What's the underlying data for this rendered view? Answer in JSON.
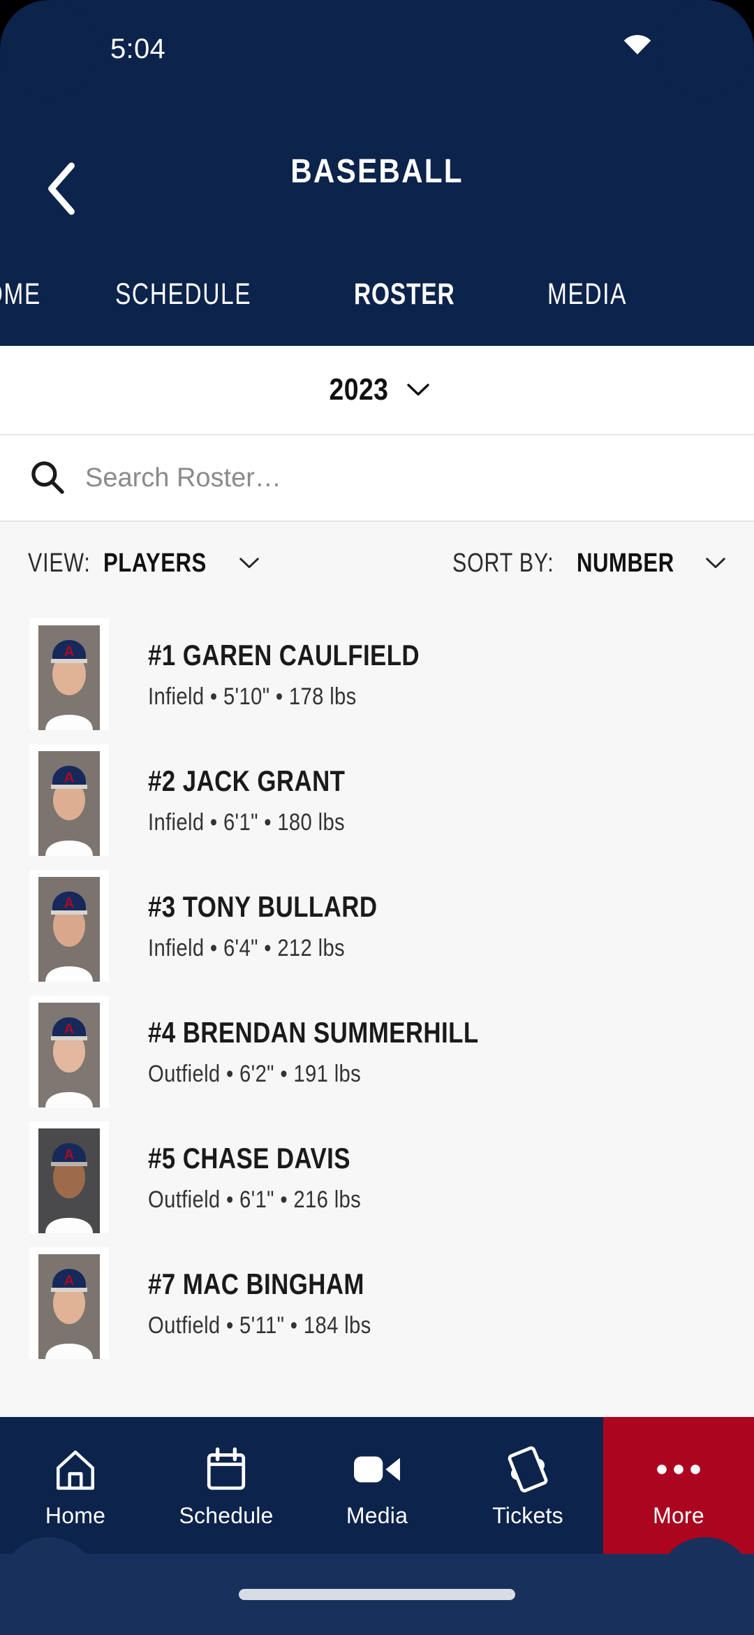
{
  "status_bar": {
    "time": "5:04",
    "icons": [
      "wifi-icon",
      "cellular-signal-icon",
      "battery-icon"
    ]
  },
  "header": {
    "back_label": "chevron-left-icon",
    "title": "BASEBALL",
    "tabs": [
      {
        "label": "HOME",
        "active": false,
        "clipped": true
      },
      {
        "label": "SCHEDULE",
        "active": false
      },
      {
        "label": "ROSTER",
        "active": true
      },
      {
        "label": "MEDIA",
        "active": false
      }
    ]
  },
  "season_selector": {
    "value": "2023",
    "chevron": "chevron-down-icon"
  },
  "search": {
    "icon": "search-icon",
    "placeholder": "Search Roster…",
    "value": ""
  },
  "filters": {
    "view": {
      "prefix": "VIEW:",
      "value": "PLAYERS",
      "chevron": "chevron-down-icon"
    },
    "sort": {
      "prefix": "SORT BY:",
      "value": "NUMBER",
      "chevron": "chevron-down-icon"
    }
  },
  "roster": [
    {
      "number": "#1",
      "name": "GAREN CAULFIELD",
      "display": "#1 GAREN CAULFIELD",
      "position": "Infield",
      "height": "5'10\"",
      "weight": "178 lbs",
      "meta": "Infield • 5'10\" • 178 lbs"
    },
    {
      "number": "#2",
      "name": "JACK GRANT",
      "display": "#2 JACK GRANT",
      "position": "Infield",
      "height": "6'1\"",
      "weight": "180 lbs",
      "meta": "Infield • 6'1\" • 180 lbs"
    },
    {
      "number": "#3",
      "name": "TONY BULLARD",
      "display": "#3 TONY BULLARD",
      "position": "Infield",
      "height": "6'4\"",
      "weight": "212 lbs",
      "meta": "Infield • 6'4\" • 212 lbs"
    },
    {
      "number": "#4",
      "name": "BRENDAN SUMMERHILL",
      "display": "#4 BRENDAN SUMMERHILL",
      "position": "Outfield",
      "height": "6'2\"",
      "weight": "191 lbs",
      "meta": "Outfield • 6'2\" • 191 lbs"
    },
    {
      "number": "#5",
      "name": "CHASE DAVIS",
      "display": "#5 CHASE DAVIS",
      "position": "Outfield",
      "height": "6'1\"",
      "weight": "216 lbs",
      "meta": "Outfield • 6'1\" • 216 lbs"
    },
    {
      "number": "#7",
      "name": "MAC BINGHAM",
      "display": "#7 MAC BINGHAM",
      "position": "Outfield",
      "height": "5'11\"",
      "weight": "184 lbs",
      "meta": "Outfield • 5'11\" • 184 lbs"
    }
  ],
  "bottom_nav": [
    {
      "label": "Home",
      "icon": "home-icon",
      "highlighted": false
    },
    {
      "label": "Schedule",
      "icon": "calendar-icon",
      "highlighted": false
    },
    {
      "label": "Media",
      "icon": "video-camera-icon",
      "highlighted": false
    },
    {
      "label": "Tickets",
      "icon": "ticket-icon",
      "highlighted": false
    },
    {
      "label": "More",
      "icon": "ellipsis-icon",
      "highlighted": true
    }
  ],
  "colors": {
    "navy": "#0C234B",
    "crimson": "#AB0520",
    "content_bg": "#F7F7F7",
    "card_bg": "#FFFFFF",
    "text_dark": "#1A1A1A"
  }
}
